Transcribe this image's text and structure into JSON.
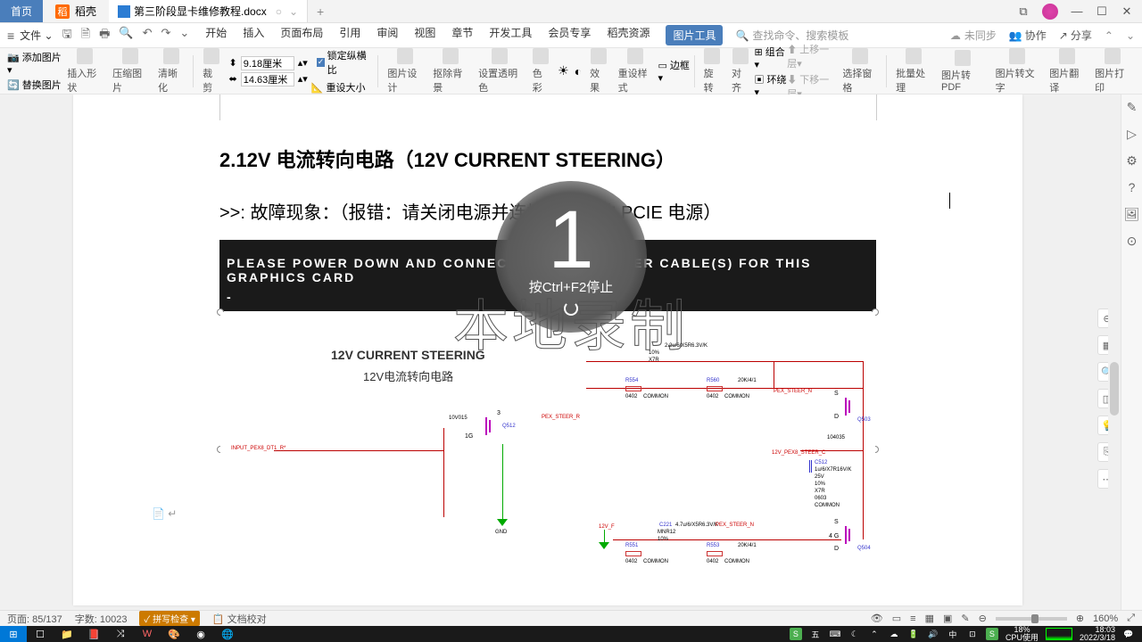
{
  "titlebar": {
    "home_tab": "首页",
    "docao_tab": "稻壳",
    "doc_tab": "第三阶段显卡维修教程.docx",
    "tab_modified": "○",
    "add_tab": "+"
  },
  "menubar": {
    "file": "文件",
    "tabs": {
      "start": "开始",
      "insert": "插入",
      "page_layout": "页面布局",
      "references": "引用",
      "review": "审阅",
      "view": "视图",
      "section": "章节",
      "dev_tools": "开发工具",
      "member": "会员专享",
      "docao_res": "稻壳资源",
      "pic_tools": "图片工具"
    },
    "search_placeholder": "查找命令、搜索模板",
    "nosync": "未同步",
    "collab": "协作",
    "share": "分享"
  },
  "ribbon": {
    "add_pic": "添加图片",
    "replace_pic": "替换图片",
    "insert_shape": "插入形状",
    "compress": "压缩图片",
    "sharpen": "清晰化",
    "crop": "裁剪",
    "width_val": "9.18厘米",
    "height_val": "14.63厘米",
    "lock_ratio": "锁定纵横比",
    "reset_size": "重设大小",
    "pic_design": "图片设计",
    "remove_bg": "抠除背景",
    "transparency": "设置透明色",
    "recolor": "色彩",
    "effects": "效果",
    "reset_style": "重设样式",
    "border": "边框",
    "rotate": "旋转",
    "align": "对齐",
    "group": "组合",
    "wrap": "环绕",
    "up_layer": "上移一层",
    "down_layer": "下移一层",
    "sel_pane": "选择窗格",
    "batch": "批量处理",
    "pic2pdf": "图片转PDF",
    "pic2text": "图片转文字",
    "pic_translate": "图片翻译",
    "pic_print": "图片打印"
  },
  "doc": {
    "heading": "2.12V 电流转向电路（12V CURRENT STEERING）",
    "fault_label": ">>: 故障现象：（报错：请关闭电源并连接此显卡的 PCIE 电源）",
    "bios_line1": "PLEASE POWER DOWN AND CONNECT THE PCIe POWER CABLE(S) FOR THIS GRAPHICS CARD",
    "bios_line2": "-",
    "schematic": {
      "title": "12V CURRENT STEERING",
      "subtitle": "12V电流转向电路",
      "input_label": "INPUT_PEX8_DT1_R*",
      "pex_steer_r": "PEX_STEER_R",
      "pex_steer_n": "PEX_STEER_N",
      "q512": "Q512",
      "r554": "R554",
      "r560": "R560",
      "r551": "R551",
      "r553": "R553",
      "c221": "C221",
      "c512": "C512",
      "q503": "Q503",
      "q504": "Q504",
      "r560_val": "20K/4/1",
      "r554_val": "COMMON",
      "c512_val": "1u/6/X7R16V/K",
      "c221_val": "4.7u/6/X5R6.3V/K",
      "c211_val": "2.2u/6/X5R6.3V/K",
      "gnd": "GND",
      "f12v": "12V_F",
      "steer_c": "12V_PEX8_STEER_C",
      "device": "10V015",
      "device2": "104035",
      "val_25v": "25V",
      "val_10": "10%",
      "val_x7r": "X7R",
      "val_0603": "0603",
      "common": "COMMON",
      "val_0402": "0402"
    }
  },
  "countdown": {
    "number": "1",
    "hint": "按Ctrl+F2停止"
  },
  "watermark": "本地录制",
  "statusbar": {
    "page": "页面: 85/137",
    "wordcount": "字数: 10023",
    "spellcheck": "拼写检查",
    "proofread": "文档校对",
    "zoom": "160%"
  },
  "tray": {
    "cpu_pct": "18%",
    "cpu_label": "CPU使用",
    "ime": "五",
    "time": "18:03",
    "date": "2022/3/18",
    "ime_mode": "中"
  }
}
